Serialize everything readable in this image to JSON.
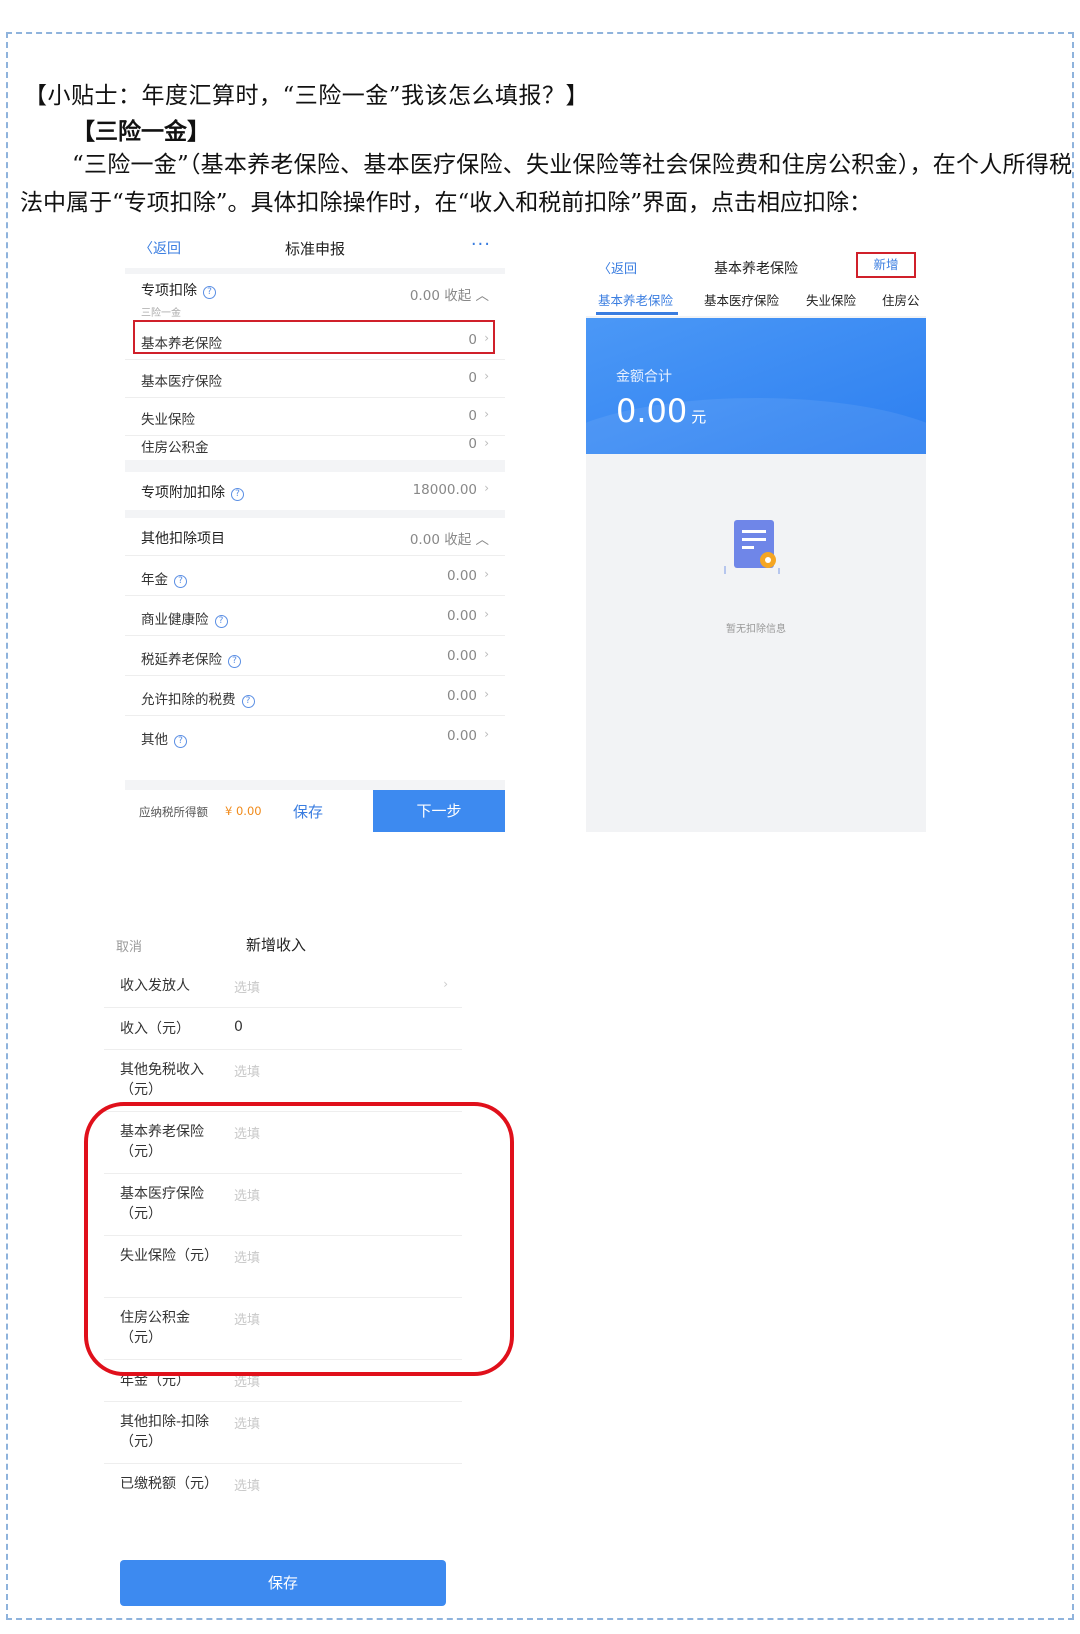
{
  "doc": {
    "tip_title": "【小贴士：年度汇算时，“三险一金”我该怎么填报？】",
    "sub_title": "【三险一金】",
    "paragraph": "“三险一金”（基本养老保险、基本医疗保险、失业保险等社会保险费和住房公积金），在个人所得税法中属于“专项扣除”。具体扣除操作时，在“收入和税前扣除”界面，点击相应扣除："
  },
  "screen1": {
    "back": "〈返回",
    "title": "标准申报",
    "more": "···",
    "special": {
      "label": "专项扣除",
      "hint": "三险一金",
      "value": "0.00 收起 ︿"
    },
    "items": [
      {
        "label": "基本养老保险",
        "value": "0"
      },
      {
        "label": "基本医疗保险",
        "value": "0"
      },
      {
        "label": "失业保险",
        "value": "0"
      },
      {
        "label": "住房公积金",
        "value": "0"
      }
    ],
    "additional": {
      "label": "专项附加扣除",
      "value": "18000.00"
    },
    "other": {
      "label": "其他扣除项目",
      "value": "0.00 收起 ︿"
    },
    "other_items": [
      {
        "label": "年金",
        "value": "0.00"
      },
      {
        "label": "商业健康险",
        "value": "0.00"
      },
      {
        "label": "税延养老保险",
        "value": "0.00"
      },
      {
        "label": "允许扣除的税费",
        "value": "0.00"
      },
      {
        "label": "其他",
        "value": "0.00"
      }
    ],
    "footer": {
      "due_label": "应纳税所得额",
      "due_value": "¥ 0.00",
      "save": "保存",
      "next": "下一步"
    }
  },
  "screen2": {
    "back": "〈返回",
    "title": "基本养老保险",
    "add": "新增",
    "tabs": [
      "基本养老保险",
      "基本医疗保险",
      "失业保险",
      "住房公"
    ],
    "sum_label": "金额合计",
    "sum_value": "0.00",
    "sum_unit": "元",
    "empty": "暂无扣除信息"
  },
  "screen3": {
    "cancel": "取消",
    "title": "新增收入",
    "fields": [
      {
        "label": "收入发放人",
        "value": "选填"
      },
      {
        "label": "收入（元）",
        "value": "0"
      },
      {
        "label": "其他免税收入（元）",
        "value": "选填"
      },
      {
        "label": "基本养老保险（元）",
        "value": "选填"
      },
      {
        "label": "基本医疗保险（元）",
        "value": "选填"
      },
      {
        "label": "失业保险（元）",
        "value": "选填"
      },
      {
        "label": "住房公积金（元）",
        "value": "选填"
      },
      {
        "label": "年金（元）",
        "value": "选填"
      },
      {
        "label": "其他扣除-扣除（元）",
        "value": "选填"
      },
      {
        "label": "已缴税额（元）",
        "value": "选填"
      }
    ],
    "save": "保存"
  },
  "colors": {
    "accent": "#3d8af0",
    "highlight": "#d0202a",
    "orange": "#f08a1a"
  }
}
